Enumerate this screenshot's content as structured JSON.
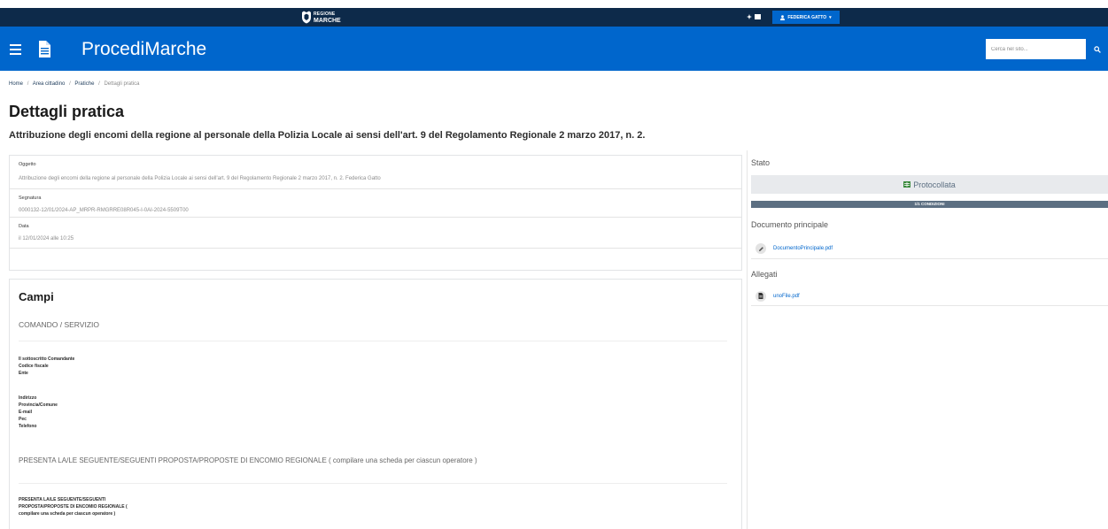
{
  "topbar": {
    "logo_line1": "REGIONE",
    "logo_line2": "MARCHE",
    "user_label": "FEDERICA GATTO",
    "user_caret": "▾"
  },
  "header": {
    "app_title": "ProcediMarche",
    "search_placeholder": "Cerca nel sito..."
  },
  "breadcrumb": {
    "separator": "/",
    "items": [
      {
        "label": "Home"
      },
      {
        "label": "Area cittadino"
      },
      {
        "label": "Pratiche"
      },
      {
        "label": "Dettagli pratica"
      }
    ]
  },
  "page": {
    "title": "Dettagli pratica",
    "subtitle": "Attribuzione degli encomi della regione al personale della Polizia Locale ai sensi dell'art. 9 del Regolamento Regionale 2 marzo 2017, n. 2."
  },
  "details": [
    {
      "label": "Oggetto",
      "value": "Attribuzione degli encomi della regione al personale della Polizia Locale ai sensi dell'art. 9 del Regolamento Regionale 2 marzo 2017, n. 2. Federica Gatto"
    },
    {
      "label": "Segnatura",
      "value": "0000132-12/01/2024-AP_MRPR-RMGRRE08R045-I-0AI-2024-5509T00"
    },
    {
      "label": "Data",
      "value": "il 12/01/2024 alle 10:25"
    }
  ],
  "fields": {
    "title": "Campi",
    "section1_title": "COMANDO / SERVIZIO",
    "group1": [
      "Il sottoscritto Comandante",
      "Codice fiscale",
      "Ente"
    ],
    "group2": [
      "Indirizzo",
      "Provincia/Comune",
      "E-mail",
      "Pec",
      "Telefono"
    ],
    "section2_title": "PRESENTA LA/LE SEGUENTE/SEGUENTI PROPOSTA/PROPOSTE DI ENCOMIO REGIONALE ( compilare una scheda per ciascun operatore )",
    "group3": [
      "PRESENTA LA/LE SEGUENTE/SEGUENTI",
      "PROPOSTA/PROPOSTE DI ENCOMIO REGIONALE (",
      "compilare una scheda per ciascun operatore )"
    ]
  },
  "sidebar": {
    "status_label": "Stato",
    "status_value": "Protocollata",
    "status_icon": "protocol-icon",
    "progress_label": "1/1 CONDIZIONI",
    "main_doc_label": "Documento principale",
    "main_doc_file": "DocumentoPrincipale.pdf",
    "main_doc_icon": "signature-icon",
    "attachments_label": "Allegati",
    "attachments": [
      {
        "file": "unoFile.pdf",
        "icon": "file-icon"
      }
    ]
  },
  "colors": {
    "primary": "#0066cc",
    "topbar": "#0d2a4a",
    "status": "#3b8a3e",
    "progress": "#5c6f82"
  }
}
